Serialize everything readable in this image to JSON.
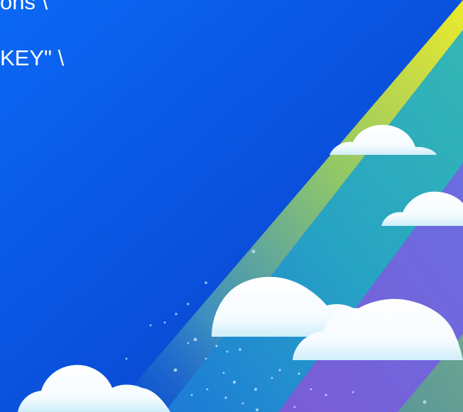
{
  "slide": {
    "code_lines": [
      "ons \\",
      "KEY\" \\"
    ],
    "colors": {
      "background_light": "#0a66f2",
      "background_dark": "#073aae",
      "stripe_yellow": "#e8e830",
      "stripe_teal": "#2aa9b8",
      "stripe_purple": "#6f64d8",
      "cloud": "#ffffff"
    },
    "illustration": "cloud-rainbow-illustration"
  }
}
